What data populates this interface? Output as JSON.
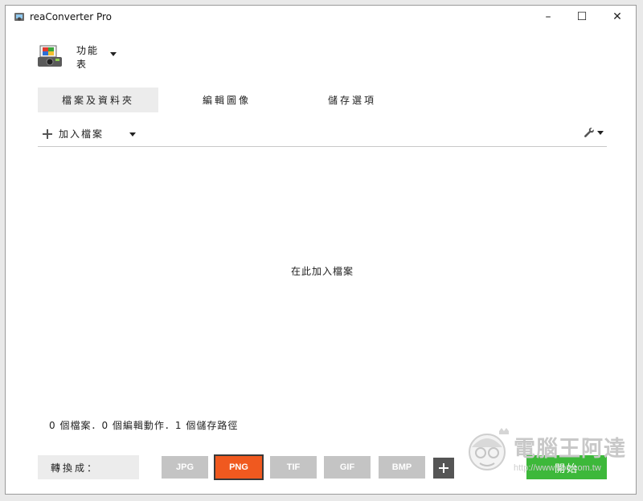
{
  "window": {
    "title": "reaConverter Pro",
    "minimize": "–",
    "maximize": "☐",
    "close": "✕"
  },
  "menu": {
    "label": "功能表"
  },
  "tabs": [
    {
      "label": "檔案及資料夾",
      "active": true
    },
    {
      "label": "編輯圖像",
      "active": false
    },
    {
      "label": "儲存選項",
      "active": false
    }
  ],
  "toolbar": {
    "add_files_label": "加入檔案"
  },
  "drop_zone": {
    "text": "在此加入檔案"
  },
  "status": {
    "text": "0 個檔案．0 個編輯動作．1 個儲存路徑"
  },
  "convert": {
    "label": "轉換成：",
    "formats": [
      "JPG",
      "PNG",
      "TIF",
      "GIF",
      "BMP"
    ],
    "selected": "PNG",
    "start_label": "開始"
  },
  "watermark": {
    "text": "電腦王阿達",
    "url": "http://www.koc.com.tw"
  },
  "colors": {
    "selected_format": "#f0591f",
    "start_button": "#3db83a",
    "format_inactive": "#c4c4c4"
  }
}
